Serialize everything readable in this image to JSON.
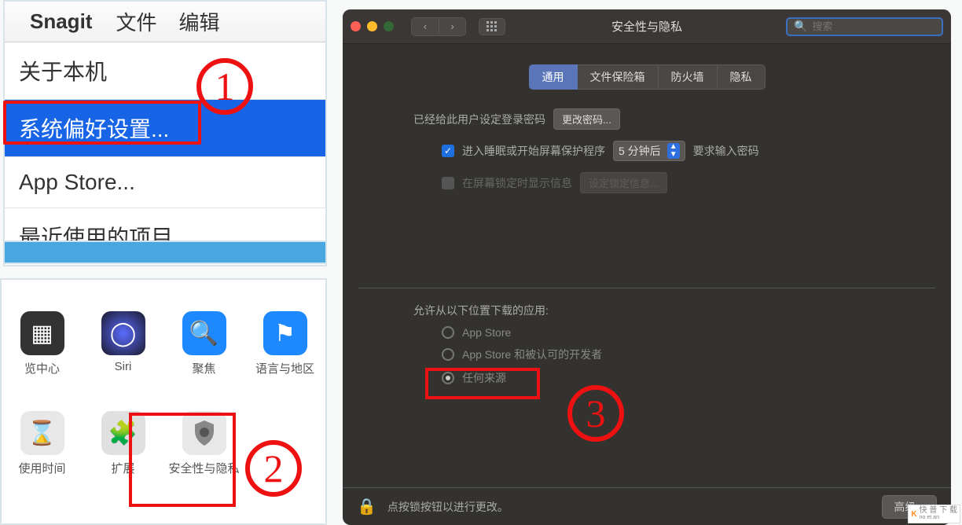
{
  "panel1": {
    "menubar": {
      "app": "Snagit",
      "file": "文件",
      "edit": "编辑"
    },
    "dropdown": {
      "about": "关于本机",
      "systemPrefs": "系统偏好设置...",
      "appStore": "App Store...",
      "recent": "最近使用的项目"
    }
  },
  "panel2": {
    "items": [
      {
        "label": "览中心",
        "icon": "mission"
      },
      {
        "label": "Siri",
        "icon": "siri"
      },
      {
        "label": "聚焦",
        "icon": "spotlight"
      },
      {
        "label": "语言与地区",
        "icon": "lang"
      },
      {
        "label": "使用时间",
        "icon": "time"
      },
      {
        "label": "扩展",
        "icon": "ext"
      },
      {
        "label": "安全性与隐私",
        "icon": "sec"
      }
    ]
  },
  "secWindow": {
    "title": "安全性与隐私",
    "searchPlaceholder": "搜索",
    "tabs": {
      "general": "通用",
      "filevault": "文件保险箱",
      "firewall": "防火墙",
      "privacy": "隐私"
    },
    "loginMsg": "已经给此用户设定登录密码",
    "changePwd": "更改密码...",
    "requirePwdPrefix": "进入睡眠或开始屏幕保护程序",
    "requirePwdSelect": "5 分钟后",
    "requirePwdSuffix": "要求输入密码",
    "lockMsg": "在屏幕锁定时显示信息",
    "setLockMsg": "设定锁定信息...",
    "allowTitle": "允许从以下位置下载的应用:",
    "allowOptions": {
      "appStore": "App Store",
      "identified": "App Store 和被认可的开发者",
      "anywhere": "任何来源"
    },
    "unlockHint": "点按锁按钮以进行更改。",
    "advanced": "高级..."
  },
  "badges": {
    "one": "1",
    "two": "2",
    "three": "3"
  },
  "watermark": {
    "brand": "K",
    "text1": "快 普 下 载",
    "text2": "no et an"
  }
}
